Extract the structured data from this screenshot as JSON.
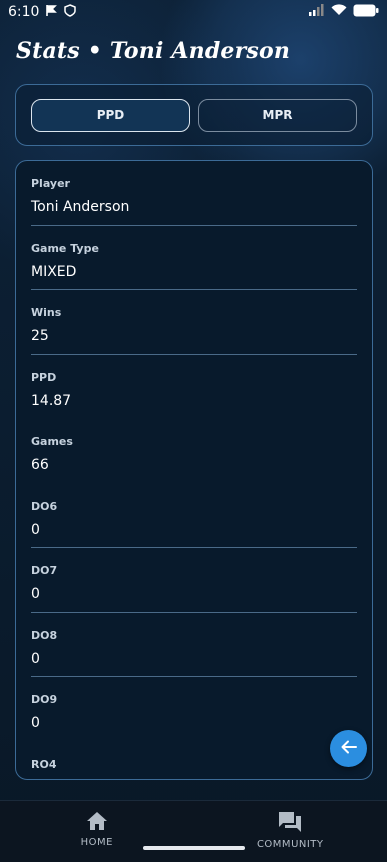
{
  "status_bar": {
    "time": "6:10",
    "icons": [
      "notification-flag-icon",
      "shield-icon",
      "signal-icon",
      "wifi-icon",
      "battery-icon"
    ]
  },
  "header": {
    "title": "Stats • Toni Anderson"
  },
  "toggle": {
    "options": [
      {
        "label": "PPD",
        "active": true
      },
      {
        "label": "MPR",
        "active": false
      }
    ]
  },
  "stats": [
    {
      "label": "Player",
      "value": "Toni Anderson"
    },
    {
      "label": "Game Type",
      "value": "MIXED"
    },
    {
      "label": "Wins",
      "value": "25"
    },
    {
      "label": "PPD",
      "value": "14.87"
    },
    {
      "label": "Games",
      "value": "66"
    },
    {
      "label": "DO6",
      "value": "0"
    },
    {
      "label": "DO7",
      "value": "0"
    },
    {
      "label": "DO8",
      "value": "0"
    },
    {
      "label": "DO9",
      "value": "0"
    },
    {
      "label": "RO4",
      "value": ""
    }
  ],
  "fab": {
    "icon": "arrow-left-icon"
  },
  "bottom_nav": [
    {
      "label": "HOME",
      "icon": "home-icon"
    },
    {
      "label": "COMMUNITY",
      "icon": "forum-icon"
    }
  ],
  "colors": {
    "background": "#0a1a2b",
    "card_border": "#3c6b97",
    "accent": "#2b8ee0",
    "nav_background": "#0c1520"
  }
}
